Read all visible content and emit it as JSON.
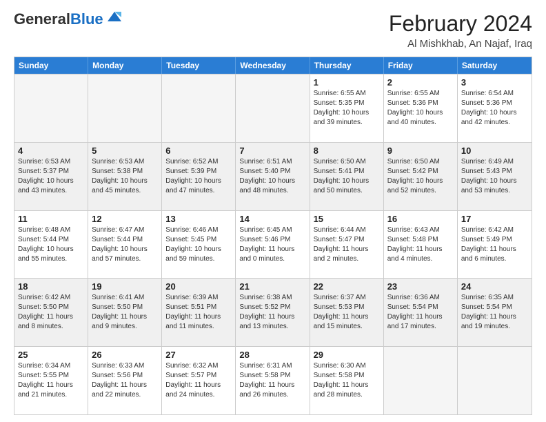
{
  "header": {
    "logo_line1": "General",
    "logo_line2": "Blue",
    "month": "February 2024",
    "location": "Al Mishkhab, An Najaf, Iraq"
  },
  "weekdays": [
    "Sunday",
    "Monday",
    "Tuesday",
    "Wednesday",
    "Thursday",
    "Friday",
    "Saturday"
  ],
  "rows": [
    [
      {
        "day": "",
        "lines": []
      },
      {
        "day": "",
        "lines": []
      },
      {
        "day": "",
        "lines": []
      },
      {
        "day": "",
        "lines": []
      },
      {
        "day": "1",
        "lines": [
          "Sunrise: 6:55 AM",
          "Sunset: 5:35 PM",
          "Daylight: 10 hours",
          "and 39 minutes."
        ]
      },
      {
        "day": "2",
        "lines": [
          "Sunrise: 6:55 AM",
          "Sunset: 5:36 PM",
          "Daylight: 10 hours",
          "and 40 minutes."
        ]
      },
      {
        "day": "3",
        "lines": [
          "Sunrise: 6:54 AM",
          "Sunset: 5:36 PM",
          "Daylight: 10 hours",
          "and 42 minutes."
        ]
      }
    ],
    [
      {
        "day": "4",
        "lines": [
          "Sunrise: 6:53 AM",
          "Sunset: 5:37 PM",
          "Daylight: 10 hours",
          "and 43 minutes."
        ]
      },
      {
        "day": "5",
        "lines": [
          "Sunrise: 6:53 AM",
          "Sunset: 5:38 PM",
          "Daylight: 10 hours",
          "and 45 minutes."
        ]
      },
      {
        "day": "6",
        "lines": [
          "Sunrise: 6:52 AM",
          "Sunset: 5:39 PM",
          "Daylight: 10 hours",
          "and 47 minutes."
        ]
      },
      {
        "day": "7",
        "lines": [
          "Sunrise: 6:51 AM",
          "Sunset: 5:40 PM",
          "Daylight: 10 hours",
          "and 48 minutes."
        ]
      },
      {
        "day": "8",
        "lines": [
          "Sunrise: 6:50 AM",
          "Sunset: 5:41 PM",
          "Daylight: 10 hours",
          "and 50 minutes."
        ]
      },
      {
        "day": "9",
        "lines": [
          "Sunrise: 6:50 AM",
          "Sunset: 5:42 PM",
          "Daylight: 10 hours",
          "and 52 minutes."
        ]
      },
      {
        "day": "10",
        "lines": [
          "Sunrise: 6:49 AM",
          "Sunset: 5:43 PM",
          "Daylight: 10 hours",
          "and 53 minutes."
        ]
      }
    ],
    [
      {
        "day": "11",
        "lines": [
          "Sunrise: 6:48 AM",
          "Sunset: 5:44 PM",
          "Daylight: 10 hours",
          "and 55 minutes."
        ]
      },
      {
        "day": "12",
        "lines": [
          "Sunrise: 6:47 AM",
          "Sunset: 5:44 PM",
          "Daylight: 10 hours",
          "and 57 minutes."
        ]
      },
      {
        "day": "13",
        "lines": [
          "Sunrise: 6:46 AM",
          "Sunset: 5:45 PM",
          "Daylight: 10 hours",
          "and 59 minutes."
        ]
      },
      {
        "day": "14",
        "lines": [
          "Sunrise: 6:45 AM",
          "Sunset: 5:46 PM",
          "Daylight: 11 hours",
          "and 0 minutes."
        ]
      },
      {
        "day": "15",
        "lines": [
          "Sunrise: 6:44 AM",
          "Sunset: 5:47 PM",
          "Daylight: 11 hours",
          "and 2 minutes."
        ]
      },
      {
        "day": "16",
        "lines": [
          "Sunrise: 6:43 AM",
          "Sunset: 5:48 PM",
          "Daylight: 11 hours",
          "and 4 minutes."
        ]
      },
      {
        "day": "17",
        "lines": [
          "Sunrise: 6:42 AM",
          "Sunset: 5:49 PM",
          "Daylight: 11 hours",
          "and 6 minutes."
        ]
      }
    ],
    [
      {
        "day": "18",
        "lines": [
          "Sunrise: 6:42 AM",
          "Sunset: 5:50 PM",
          "Daylight: 11 hours",
          "and 8 minutes."
        ]
      },
      {
        "day": "19",
        "lines": [
          "Sunrise: 6:41 AM",
          "Sunset: 5:50 PM",
          "Daylight: 11 hours",
          "and 9 minutes."
        ]
      },
      {
        "day": "20",
        "lines": [
          "Sunrise: 6:39 AM",
          "Sunset: 5:51 PM",
          "Daylight: 11 hours",
          "and 11 minutes."
        ]
      },
      {
        "day": "21",
        "lines": [
          "Sunrise: 6:38 AM",
          "Sunset: 5:52 PM",
          "Daylight: 11 hours",
          "and 13 minutes."
        ]
      },
      {
        "day": "22",
        "lines": [
          "Sunrise: 6:37 AM",
          "Sunset: 5:53 PM",
          "Daylight: 11 hours",
          "and 15 minutes."
        ]
      },
      {
        "day": "23",
        "lines": [
          "Sunrise: 6:36 AM",
          "Sunset: 5:54 PM",
          "Daylight: 11 hours",
          "and 17 minutes."
        ]
      },
      {
        "day": "24",
        "lines": [
          "Sunrise: 6:35 AM",
          "Sunset: 5:54 PM",
          "Daylight: 11 hours",
          "and 19 minutes."
        ]
      }
    ],
    [
      {
        "day": "25",
        "lines": [
          "Sunrise: 6:34 AM",
          "Sunset: 5:55 PM",
          "Daylight: 11 hours",
          "and 21 minutes."
        ]
      },
      {
        "day": "26",
        "lines": [
          "Sunrise: 6:33 AM",
          "Sunset: 5:56 PM",
          "Daylight: 11 hours",
          "and 22 minutes."
        ]
      },
      {
        "day": "27",
        "lines": [
          "Sunrise: 6:32 AM",
          "Sunset: 5:57 PM",
          "Daylight: 11 hours",
          "and 24 minutes."
        ]
      },
      {
        "day": "28",
        "lines": [
          "Sunrise: 6:31 AM",
          "Sunset: 5:58 PM",
          "Daylight: 11 hours",
          "and 26 minutes."
        ]
      },
      {
        "day": "29",
        "lines": [
          "Sunrise: 6:30 AM",
          "Sunset: 5:58 PM",
          "Daylight: 11 hours",
          "and 28 minutes."
        ]
      },
      {
        "day": "",
        "lines": []
      },
      {
        "day": "",
        "lines": []
      }
    ]
  ]
}
